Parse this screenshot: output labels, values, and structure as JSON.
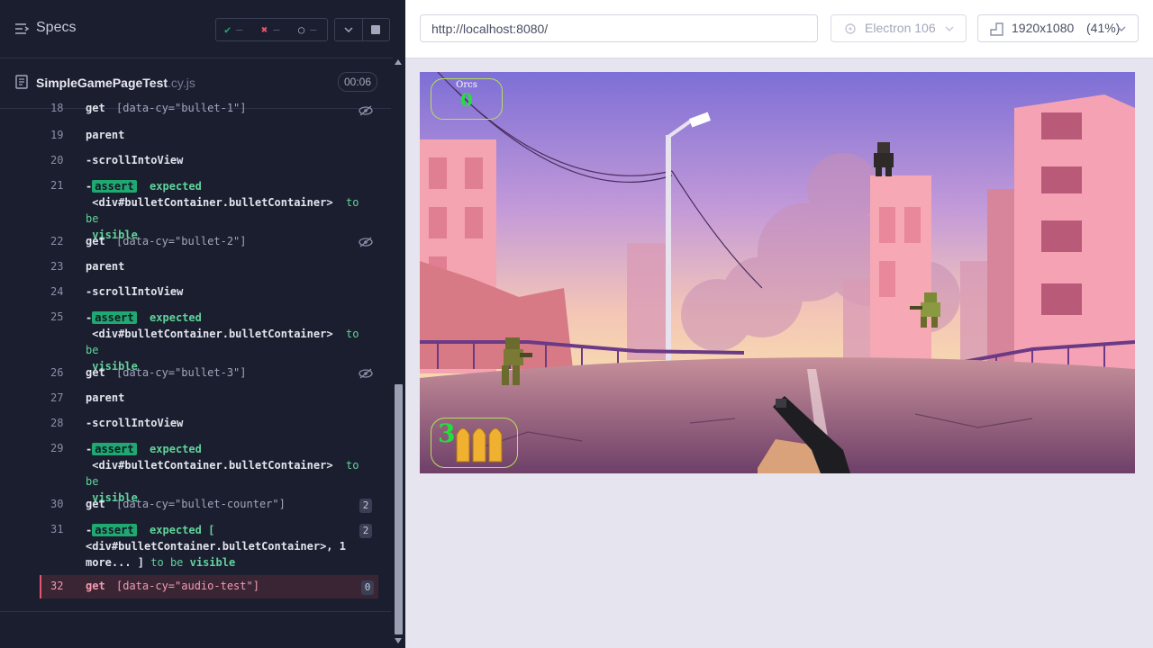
{
  "header": {
    "specs_label": "Specs",
    "passed": "—",
    "failed": "—",
    "pending": "—"
  },
  "spec": {
    "file_name": "SimpleGamePageTest",
    "file_ext": ".cy.js",
    "duration": "00:06"
  },
  "commands": [
    {
      "num": "18",
      "name": "get",
      "selector": "[data-cy=\"bullet-1\"]"
    },
    {
      "num": "19",
      "name": "parent"
    },
    {
      "num": "20",
      "name": "-scrollIntoView"
    },
    {
      "num": "21",
      "assert": "assert",
      "line1": "expected",
      "line2": "<div#bulletContainer.bulletContainer>",
      "tail": "to be",
      "line3": "visible"
    },
    {
      "num": "22",
      "name": "get",
      "selector": "[data-cy=\"bullet-2\"]"
    },
    {
      "num": "23",
      "name": "parent"
    },
    {
      "num": "24",
      "name": "-scrollIntoView"
    },
    {
      "num": "25",
      "assert": "assert",
      "line1": "expected",
      "line2": "<div#bulletContainer.bulletContainer>",
      "tail": "to be",
      "line3": "visible"
    },
    {
      "num": "26",
      "name": "get",
      "selector": "[data-cy=\"bullet-3\"]"
    },
    {
      "num": "27",
      "name": "parent"
    },
    {
      "num": "28",
      "name": "-scrollIntoView"
    },
    {
      "num": "29",
      "assert": "assert",
      "line1": "expected",
      "line2": "<div#bulletContainer.bulletContainer>",
      "tail": "to be",
      "line3": "visible"
    },
    {
      "num": "30",
      "name": "get",
      "selector": "[data-cy=\"bullet-counter\"]",
      "count": "2"
    },
    {
      "num": "31",
      "assert": "assert",
      "line1": "expected [",
      "line2": "<div#bulletContainer.bulletContainer>, 1",
      "line3a": "more... ]",
      "tail2": "to be",
      "line3b": "visible",
      "count": "2"
    },
    {
      "num": "32",
      "name": "get",
      "selector": "[data-cy=\"audio-test\"]",
      "count": "0"
    }
  ],
  "browser_bar": {
    "url": "http://localhost:8080/",
    "browser": "Electron 106",
    "viewport": "1920x1080",
    "zoom": "(41%)"
  },
  "game": {
    "orcs_label": "Orcs",
    "orcs_count": "0",
    "ammo_count": "3"
  },
  "colors": {
    "panel_bg": "#1b1e2e",
    "assert_green": "#1fa971",
    "hud_green": "#22e03a",
    "highlight": "#e45770"
  }
}
